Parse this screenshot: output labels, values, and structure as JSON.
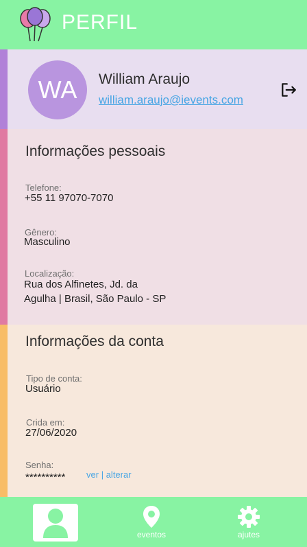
{
  "header": {
    "title": "PERFIL",
    "logo_icon": "balloons-icon"
  },
  "profile": {
    "initials": "WA",
    "name": "William Araujo",
    "email": "william.araujo@ievents.com",
    "logout_icon": "logout-icon"
  },
  "personal": {
    "title": "Informações pessoais",
    "phone_label": "Telefone:",
    "phone": "+55 11 97070-7070",
    "gender_label": "Gênero:",
    "gender": "Masculino",
    "location_label": "Localização:",
    "location_line1": "Rua dos Alfinetes, Jd. da",
    "location_line2": "Agulha | Brasil, São Paulo - SP"
  },
  "account": {
    "title": "Informações da conta",
    "type_label": "Tipo de conta:",
    "type": "Usuário",
    "created_label": "Crida em:",
    "created": "27/06/2020",
    "password_label": "Senha:",
    "password": "**********",
    "view_link": "ver",
    "separator": "|",
    "change_link": "alterar"
  },
  "nav": {
    "profile_icon": "person-icon",
    "events_label": "eventos",
    "events_icon": "map-pin-icon",
    "settings_label": "ajutes",
    "settings_icon": "gear-icon"
  },
  "colors": {
    "header": "#88f3a3",
    "profile_bg": "#e8def0",
    "profile_bar": "#b181d8",
    "personal_bg": "#f0dfe5",
    "personal_bar": "#e07aa2",
    "account_bg": "#f7e8dc",
    "account_bar": "#f8bd67",
    "link": "#47a5e4"
  }
}
